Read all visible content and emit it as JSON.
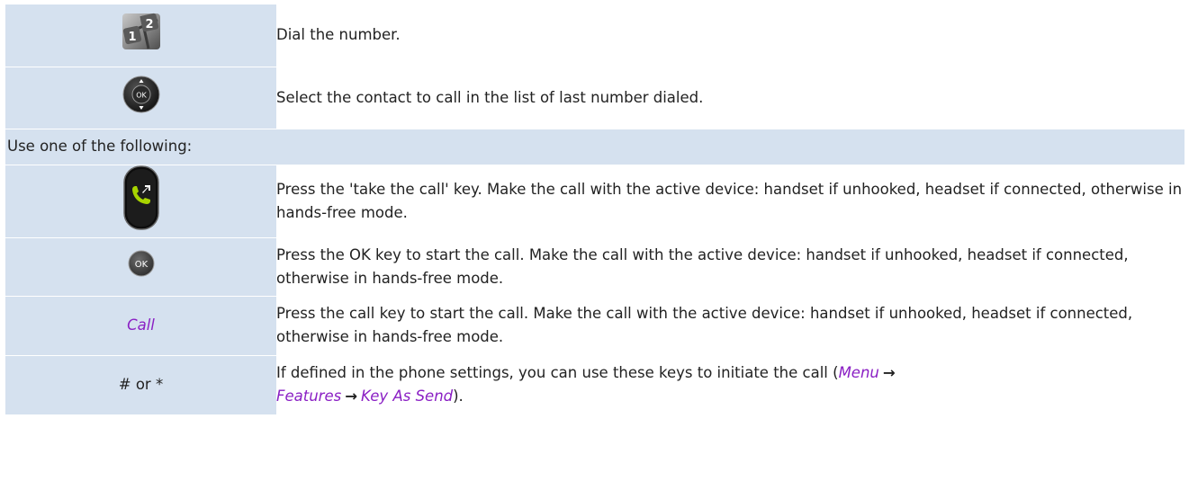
{
  "rows": [
    {
      "icon": "keypad-icon",
      "text": "Dial the number."
    },
    {
      "icon": "navigator-ok-icon",
      "text": "Select the contact to call in the list of last number dialed."
    },
    {
      "header": "Use one of the following:"
    },
    {
      "icon": "take-call-key-icon",
      "text": "Press the 'take the call' key. Make the call with the active device: handset if unhooked, headset if connected, otherwise in hands-free mode."
    },
    {
      "icon": "ok-key-icon",
      "icon_text": "OK",
      "text": "Press the OK key to start the call. Make the call with the active device: handset if unhooked, headset if connected, otherwise in hands-free mode."
    },
    {
      "label": "Call",
      "text": "Press the call key to start the call. Make the call with the active device: handset if unhooked, headset if connected, otherwise in hands-free mode."
    },
    {
      "label": "# or *",
      "text_before": "If defined in the phone settings, you can use these keys to initiate the call (",
      "path": [
        "Menu",
        "Features",
        "Key As Send"
      ],
      "text_after": ")."
    }
  ],
  "colors": {
    "row_bg": "#d5e1ef",
    "link": "#8a1fc4"
  }
}
